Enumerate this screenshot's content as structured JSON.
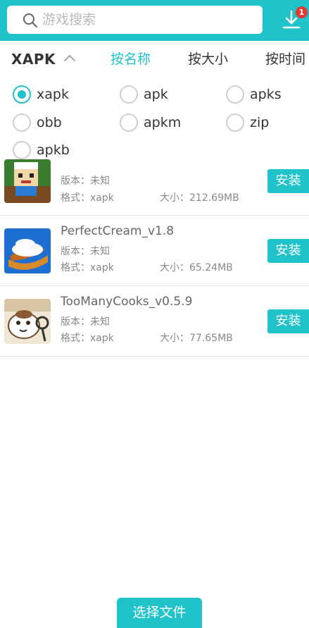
{
  "search": {
    "placeholder": "游戏搜索"
  },
  "download": {
    "badge_count": "1"
  },
  "filter": {
    "type_label": "XAPK",
    "tabs": [
      {
        "label": "按名称",
        "active": true
      },
      {
        "label": "按大小",
        "active": false
      },
      {
        "label": "按时间",
        "active": false
      }
    ],
    "formats": [
      {
        "label": "xapk",
        "checked": true
      },
      {
        "label": "apk",
        "checked": false
      },
      {
        "label": "apks",
        "checked": false
      },
      {
        "label": "obb",
        "checked": false
      },
      {
        "label": "apkm",
        "checked": false
      },
      {
        "label": "zip",
        "checked": false
      },
      {
        "label": "apkb",
        "checked": false
      }
    ]
  },
  "list": {
    "items": [
      {
        "name": "",
        "version": "版本：未知",
        "format": "格式：xapk",
        "size": "大小：212.69MB",
        "install_label": "安装",
        "icon": "pixel-character-icon"
      },
      {
        "name": "PerfectCream_v1.8",
        "version": "版本：未知",
        "format": "格式：xapk",
        "size": "大小：65.24MB",
        "install_label": "安装",
        "icon": "cream-pastry-icon"
      },
      {
        "name": "TooManyCooks_v0.5.9",
        "version": "版本：未知",
        "format": "格式：xapk",
        "size": "大小：77.65MB",
        "install_label": "安装",
        "icon": "cartoon-cook-icon"
      }
    ]
  },
  "footer": {
    "choose_file_label": "选择文件"
  },
  "colors": {
    "accent": "#1fc3c9",
    "badge": "#e53935"
  }
}
